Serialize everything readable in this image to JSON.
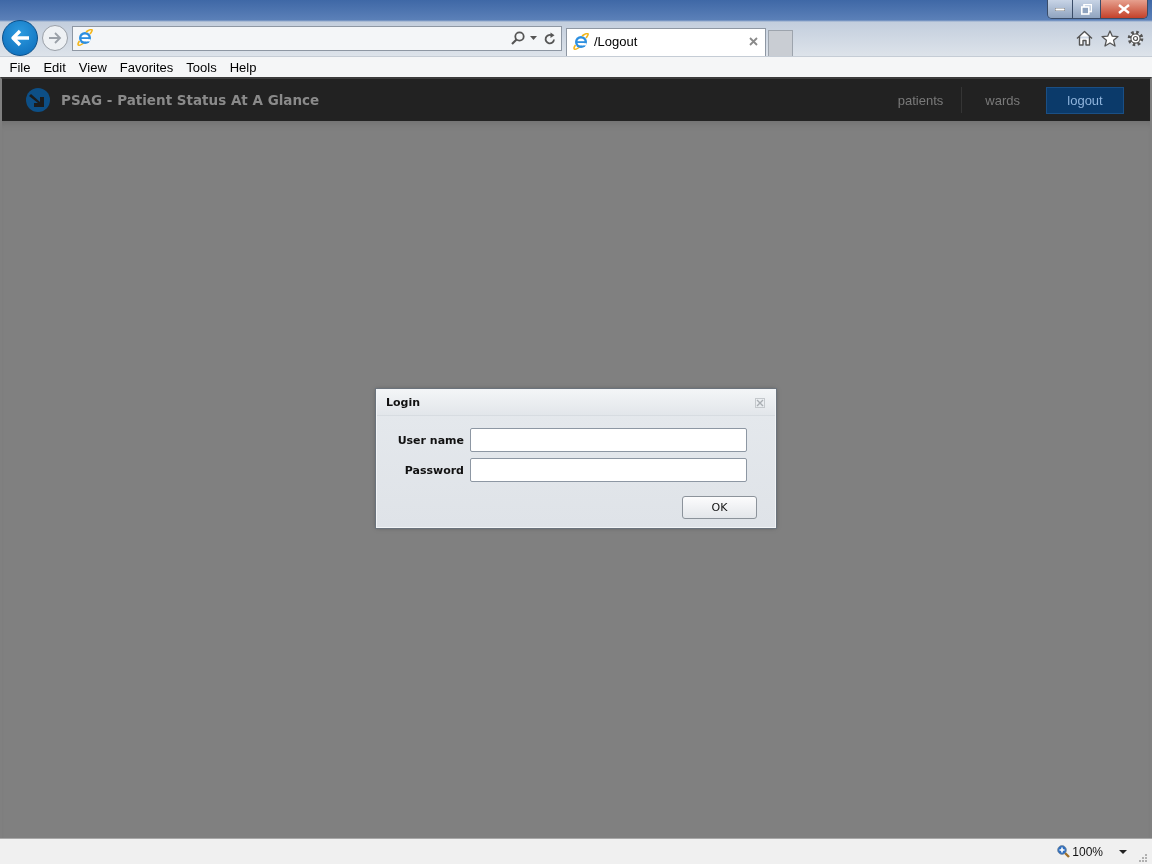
{
  "browser": {
    "tab": {
      "title": "/Logout"
    },
    "menu": [
      "File",
      "Edit",
      "View",
      "Favorites",
      "Tools",
      "Help"
    ]
  },
  "app_header": {
    "title": "PSAG - Patient Status At A Glance",
    "nav": [
      {
        "label": "patients",
        "kind": "link"
      },
      {
        "label": "wards",
        "kind": "link"
      },
      {
        "label": "logout",
        "kind": "button"
      }
    ]
  },
  "login_dialog": {
    "title": "Login",
    "fields": [
      {
        "label": "User name"
      },
      {
        "label": "Password"
      }
    ],
    "buttons": [
      "OK"
    ]
  },
  "status_bar": {
    "zoom": "100%"
  }
}
